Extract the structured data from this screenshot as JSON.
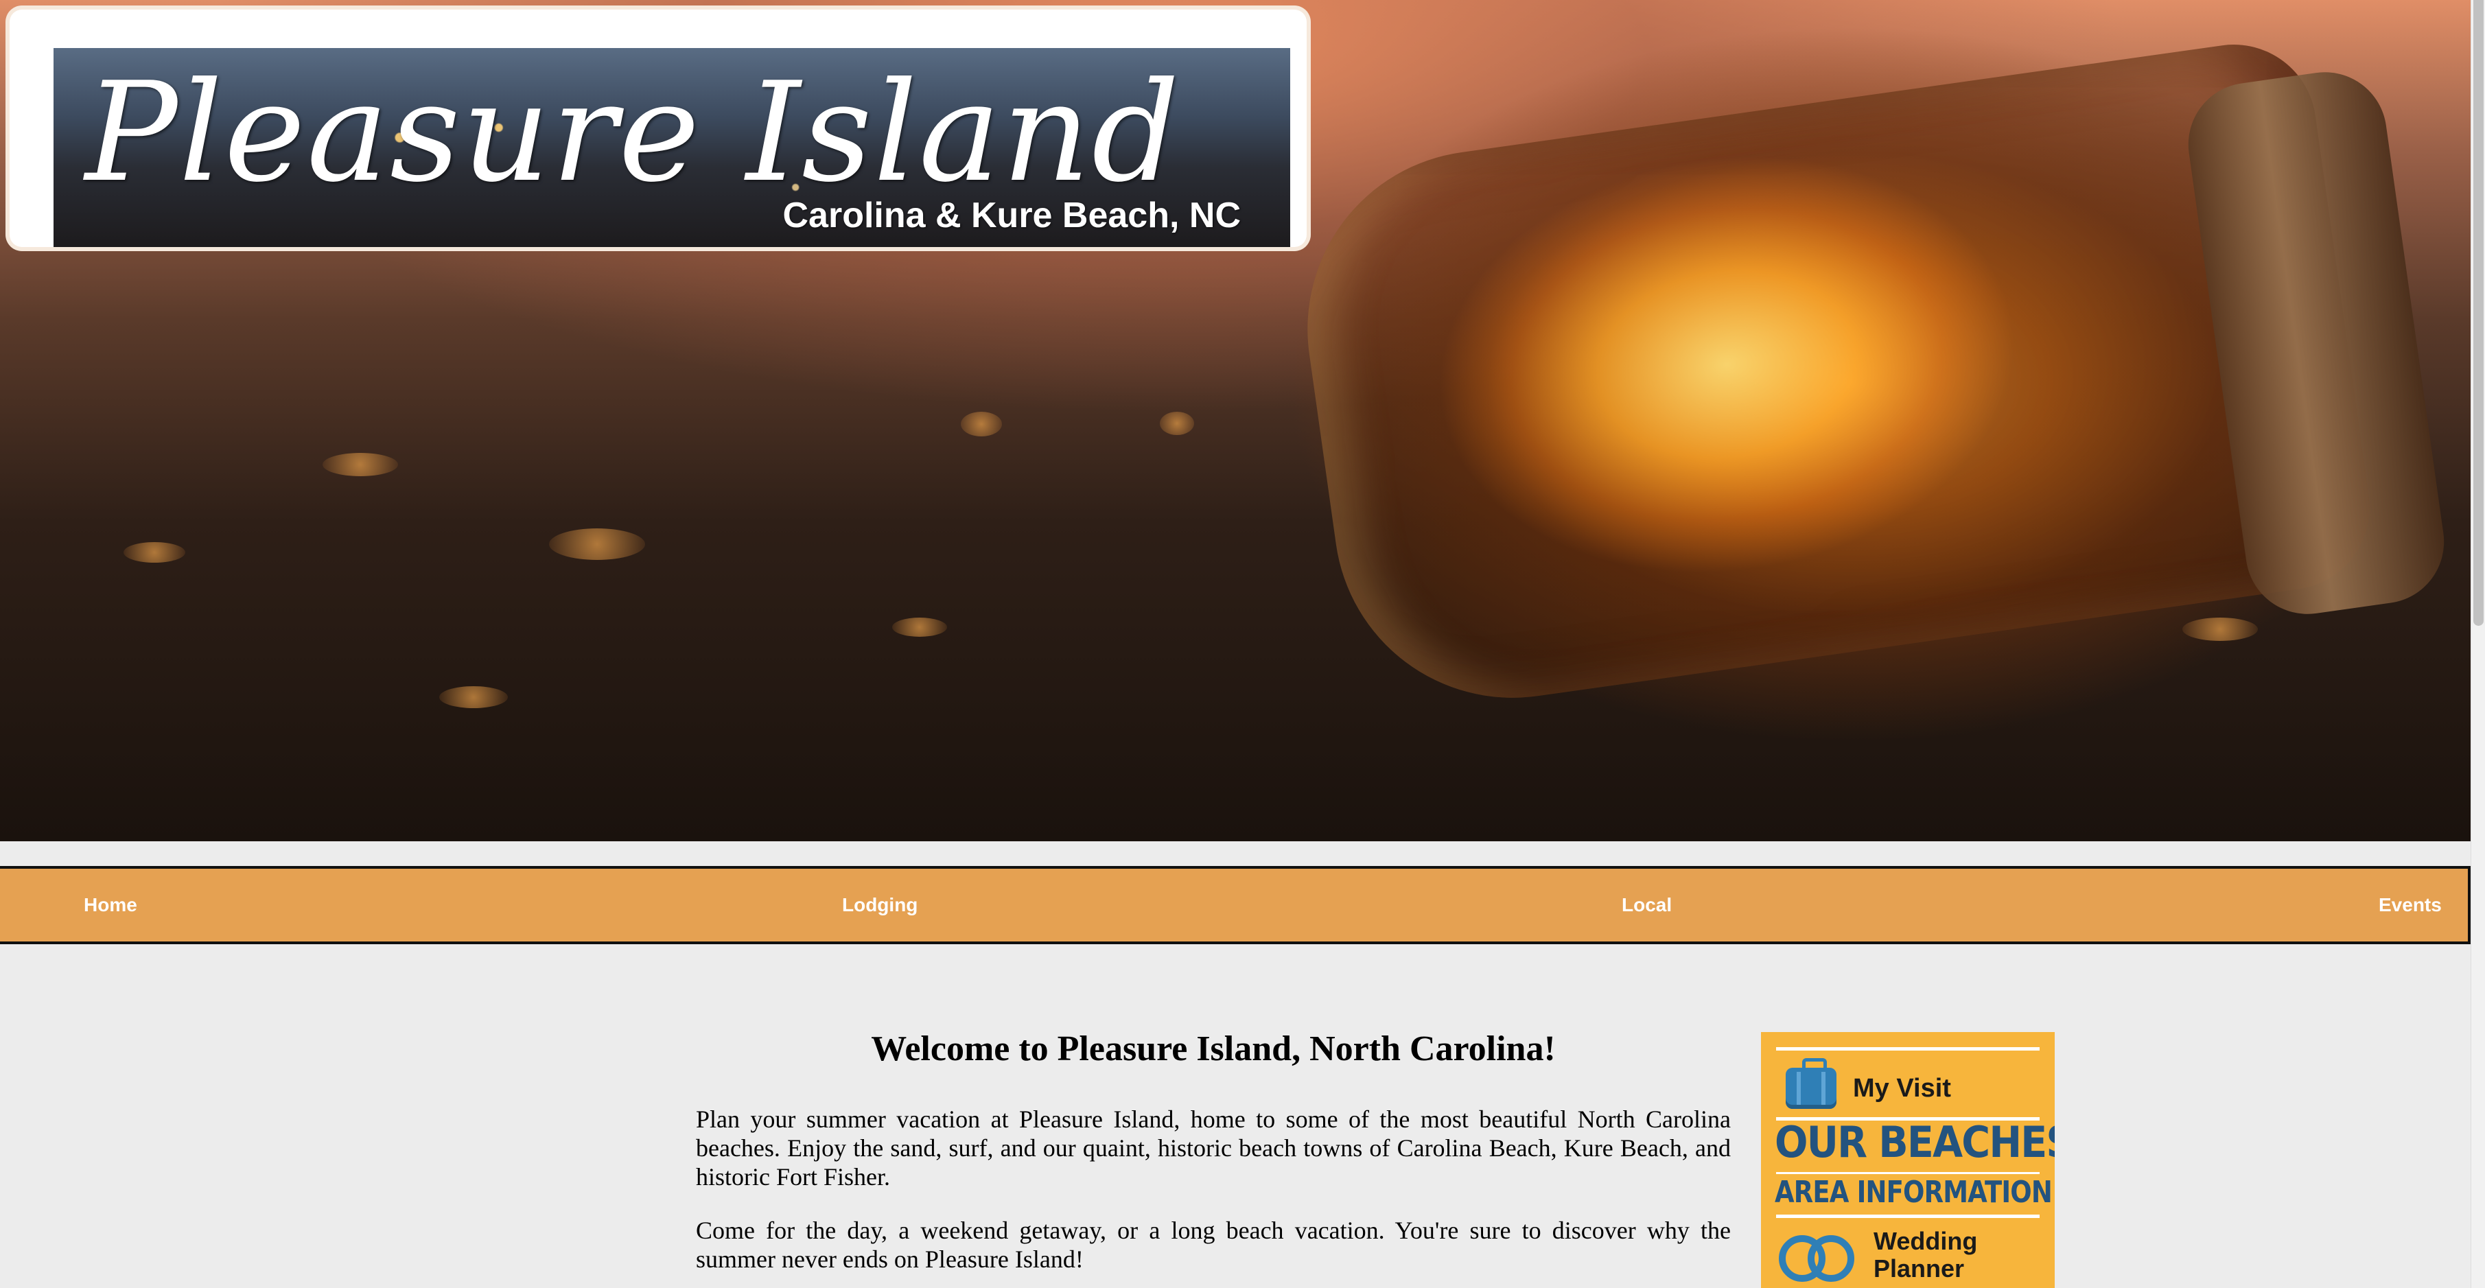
{
  "banner": {
    "title": "Pleasure Island",
    "subtitle": "Carolina & Kure Beach, NC"
  },
  "nav": {
    "items": [
      {
        "label": "Home"
      },
      {
        "label": "Lodging"
      },
      {
        "label": "Local"
      },
      {
        "label": "Events"
      }
    ]
  },
  "main": {
    "heading": "Welcome to Pleasure Island, North Carolina!",
    "paragraphs": [
      "Plan your summer vacation at Pleasure Island, home to some of the most beautiful North Carolina beaches. Enjoy the sand, surf, and our quaint, historic beach towns of Carolina Beach, Kure Beach, and historic Fort Fisher.",
      "Come for the day, a weekend getaway, or a long beach vacation. You're sure to discover why the summer never ends on Pleasure Island!"
    ]
  },
  "sidebar": {
    "my_visit": "My Visit",
    "our_beaches": "OUR BEACHES",
    "area_information": "AREA INFORMATION",
    "wedding_line1": "Wedding",
    "wedding_line2": "Planner",
    "icons": [
      "suitcase-icon",
      "wedding-rings-icon"
    ]
  },
  "colors": {
    "nav_background": "#e5a152",
    "sidebar_background": "#f7b53c",
    "sidebar_heading": "#23537f",
    "page_background": "#ececec"
  }
}
